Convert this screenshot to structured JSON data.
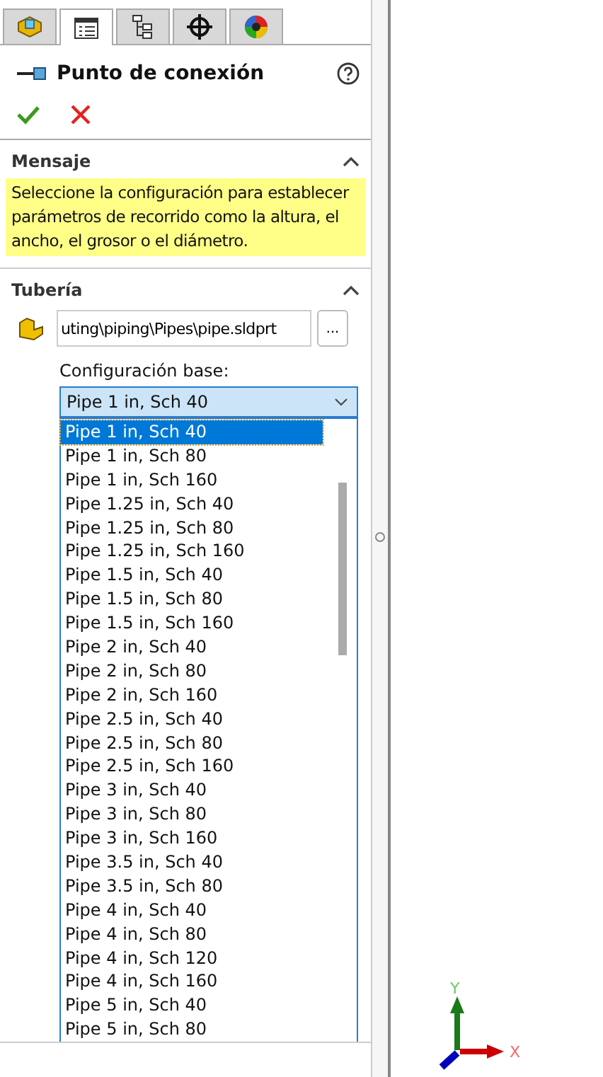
{
  "tabs": [
    {
      "kind": "part",
      "selected": false
    },
    {
      "kind": "property",
      "selected": true
    },
    {
      "kind": "config",
      "selected": false
    },
    {
      "kind": "dim",
      "selected": false
    },
    {
      "kind": "display",
      "selected": false
    }
  ],
  "panel": {
    "title": "Punto de conexión"
  },
  "message": {
    "heading": "Mensaje",
    "expanded": true,
    "text": "Seleccione la configuración para establecer parámetros de recorrido como la altura, el ancho, el grosor o el diámetro."
  },
  "pipe": {
    "heading": "Tubería",
    "expanded": true,
    "path": "uting\\piping\\Pipes\\pipe.sldprt",
    "browse": "...",
    "config_label": "Configuración base:",
    "config_value": "Pipe 1 in, Sch 40",
    "options": [
      {
        "label": "Pipe 1 in, Sch 40",
        "selected": true
      },
      {
        "label": "Pipe 1 in, Sch 80",
        "selected": false
      },
      {
        "label": "Pipe 1 in, Sch 160",
        "selected": false
      },
      {
        "label": "Pipe 1.25 in, Sch 40",
        "selected": false
      },
      {
        "label": "Pipe 1.25 in, Sch 80",
        "selected": false
      },
      {
        "label": "Pipe 1.25 in, Sch 160",
        "selected": false
      },
      {
        "label": "Pipe 1.5 in, Sch 40",
        "selected": false
      },
      {
        "label": "Pipe 1.5 in, Sch 80",
        "selected": false
      },
      {
        "label": "Pipe 1.5 in, Sch 160",
        "selected": false
      },
      {
        "label": "Pipe 2 in, Sch 40",
        "selected": false
      },
      {
        "label": "Pipe 2 in, Sch 80",
        "selected": false
      },
      {
        "label": "Pipe 2 in, Sch 160",
        "selected": false
      },
      {
        "label": "Pipe 2.5 in, Sch 40",
        "selected": false
      },
      {
        "label": "Pipe 2.5 in, Sch 80",
        "selected": false
      },
      {
        "label": "Pipe 2.5 in, Sch 160",
        "selected": false
      },
      {
        "label": "Pipe 3 in, Sch 40",
        "selected": false
      },
      {
        "label": "Pipe 3 in, Sch 80",
        "selected": false
      },
      {
        "label": "Pipe 3 in, Sch 160",
        "selected": false
      },
      {
        "label": "Pipe 3.5 in, Sch 40",
        "selected": false
      },
      {
        "label": "Pipe 3.5 in, Sch 80",
        "selected": false
      },
      {
        "label": "Pipe 4 in, Sch 40",
        "selected": false
      },
      {
        "label": "Pipe 4 in, Sch 80",
        "selected": false
      },
      {
        "label": "Pipe 4 in, Sch 120",
        "selected": false
      },
      {
        "label": "Pipe 4 in, Sch 160",
        "selected": false
      },
      {
        "label": "Pipe 5 in, Sch 40",
        "selected": false
      },
      {
        "label": "Pipe 5 in, Sch 80",
        "selected": false
      }
    ]
  },
  "triad": {
    "y_label": "Y",
    "x_label": "X"
  }
}
